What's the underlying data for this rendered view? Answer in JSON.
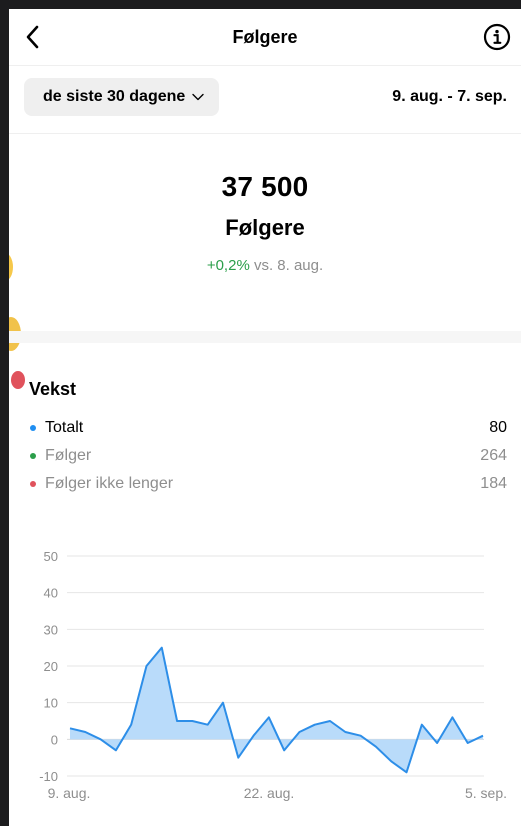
{
  "header": {
    "title": "Følgere",
    "back_icon": "chevron-left-icon",
    "info_icon": "info-icon"
  },
  "filter": {
    "range_label": "de siste 30 dagene",
    "date_range": "9. aug. - 7. sep."
  },
  "summary": {
    "count": "37 500",
    "label": "Følgere",
    "change": "+0,2%",
    "compare": "vs. 8. aug."
  },
  "growth": {
    "title": "Vekst",
    "legend": [
      {
        "label": "Totalt",
        "value": "80",
        "color": "#1f8ef1"
      },
      {
        "label": "Følger",
        "value": "264",
        "color": "#2b9e4a"
      },
      {
        "label": "Følger ikke lenger",
        "value": "184",
        "color": "#e0525c"
      }
    ]
  },
  "chart_data": {
    "type": "area",
    "x": [
      "9. aug.",
      "10. aug.",
      "11. aug.",
      "12. aug.",
      "13. aug.",
      "14. aug.",
      "15. aug.",
      "16. aug.",
      "17. aug.",
      "18. aug.",
      "19. aug.",
      "20. aug.",
      "21. aug.",
      "22. aug.",
      "23. aug.",
      "24. aug.",
      "25. aug.",
      "26. aug.",
      "27. aug.",
      "28. aug.",
      "29. aug.",
      "30. aug.",
      "31. aug.",
      "1. sep.",
      "2. sep.",
      "3. sep.",
      "4. sep.",
      "5. sep.",
      "6. sep.",
      "7. sep."
    ],
    "series": [
      {
        "values": [
          3,
          2,
          0,
          -3,
          4,
          20,
          25,
          5,
          5,
          4,
          10,
          -5,
          1,
          6,
          -3,
          2,
          4,
          5,
          2,
          1,
          -2,
          -6,
          -9,
          4,
          -1,
          6,
          -1,
          1
        ]
      }
    ],
    "xtick_labels": [
      "9. aug.",
      "22. aug.",
      "5. sep."
    ],
    "yticks": [
      50,
      40,
      30,
      20,
      10,
      0,
      -10
    ],
    "ylim": [
      -10,
      50
    ],
    "line_color": "#2d8ee8",
    "fill_color": "#b9dbfa",
    "grid": true
  }
}
